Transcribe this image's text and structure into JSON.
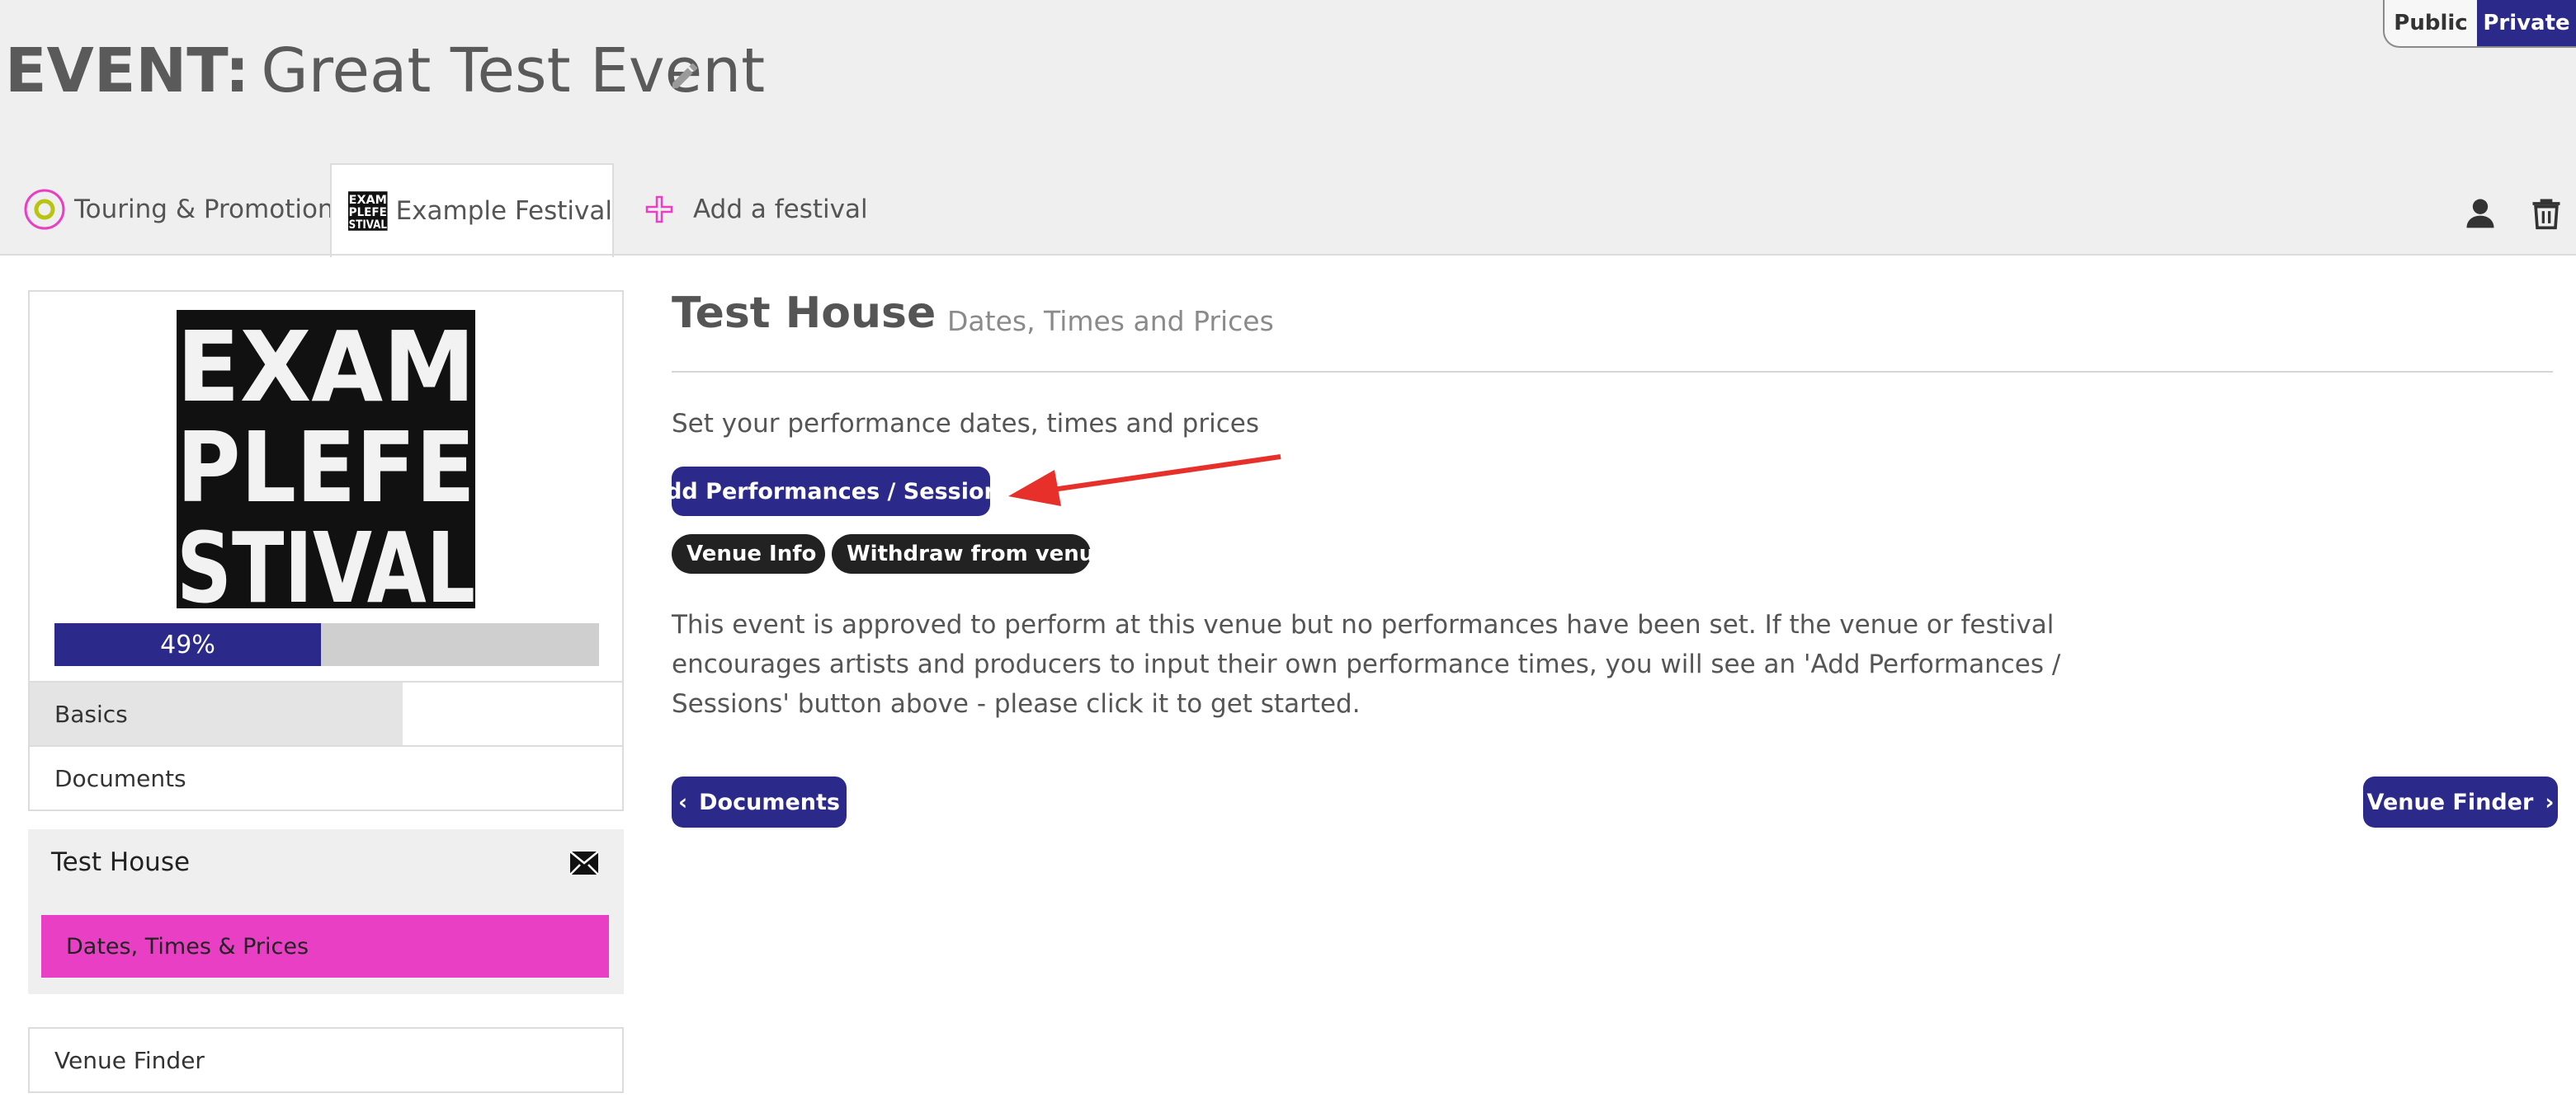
{
  "header": {
    "event_label": "EVENT:",
    "event_name": "Great Test Event"
  },
  "visibility": {
    "public_label": "Public",
    "private_label": "Private",
    "selected": "Private",
    "colors": {
      "active_bg": "#2b2a8a"
    }
  },
  "tabs": [
    {
      "label": "Touring & Promotion",
      "icon": "touring-promotion-icon"
    },
    {
      "label": "Example Festival",
      "icon": "example-festival-logo",
      "active": true
    },
    {
      "label": "Add a festival",
      "icon": "plus-icon"
    }
  ],
  "utility": {
    "icons": [
      "user-icon",
      "trash-icon"
    ]
  },
  "sidebar": {
    "logo_lines": [
      "EXAM",
      "PLEFE",
      "STIVAL"
    ],
    "progress": {
      "percent": 49,
      "label": "49%"
    },
    "items": [
      {
        "label": "Basics"
      },
      {
        "label": "Documents"
      }
    ],
    "venue_group": {
      "title": "Test House",
      "icon": "envelope-icon",
      "sub_item": "Dates, Times & Prices"
    },
    "venue_finder": "Venue Finder"
  },
  "main": {
    "title": "Test House",
    "subtitle": "Dates, Times and Prices",
    "intro": "Set your performance dates, times and prices",
    "add_button": "Add Performances / Sessions",
    "pills": {
      "venue_info": "Venue Info",
      "withdraw": "Withdraw from venue"
    },
    "description": "This event is approved to perform at this venue but no performances have been set. If the venue or festival encourages artists and producers to input their own performance times, you will see an 'Add Performances / Sessions' button above - please click it to get started.",
    "prev_button": "Documents",
    "next_button": "Venue Finder"
  },
  "colors": {
    "primary": "#2b2a8a",
    "accent_pink": "#e83fc4",
    "arrow_red": "#e8302a"
  }
}
